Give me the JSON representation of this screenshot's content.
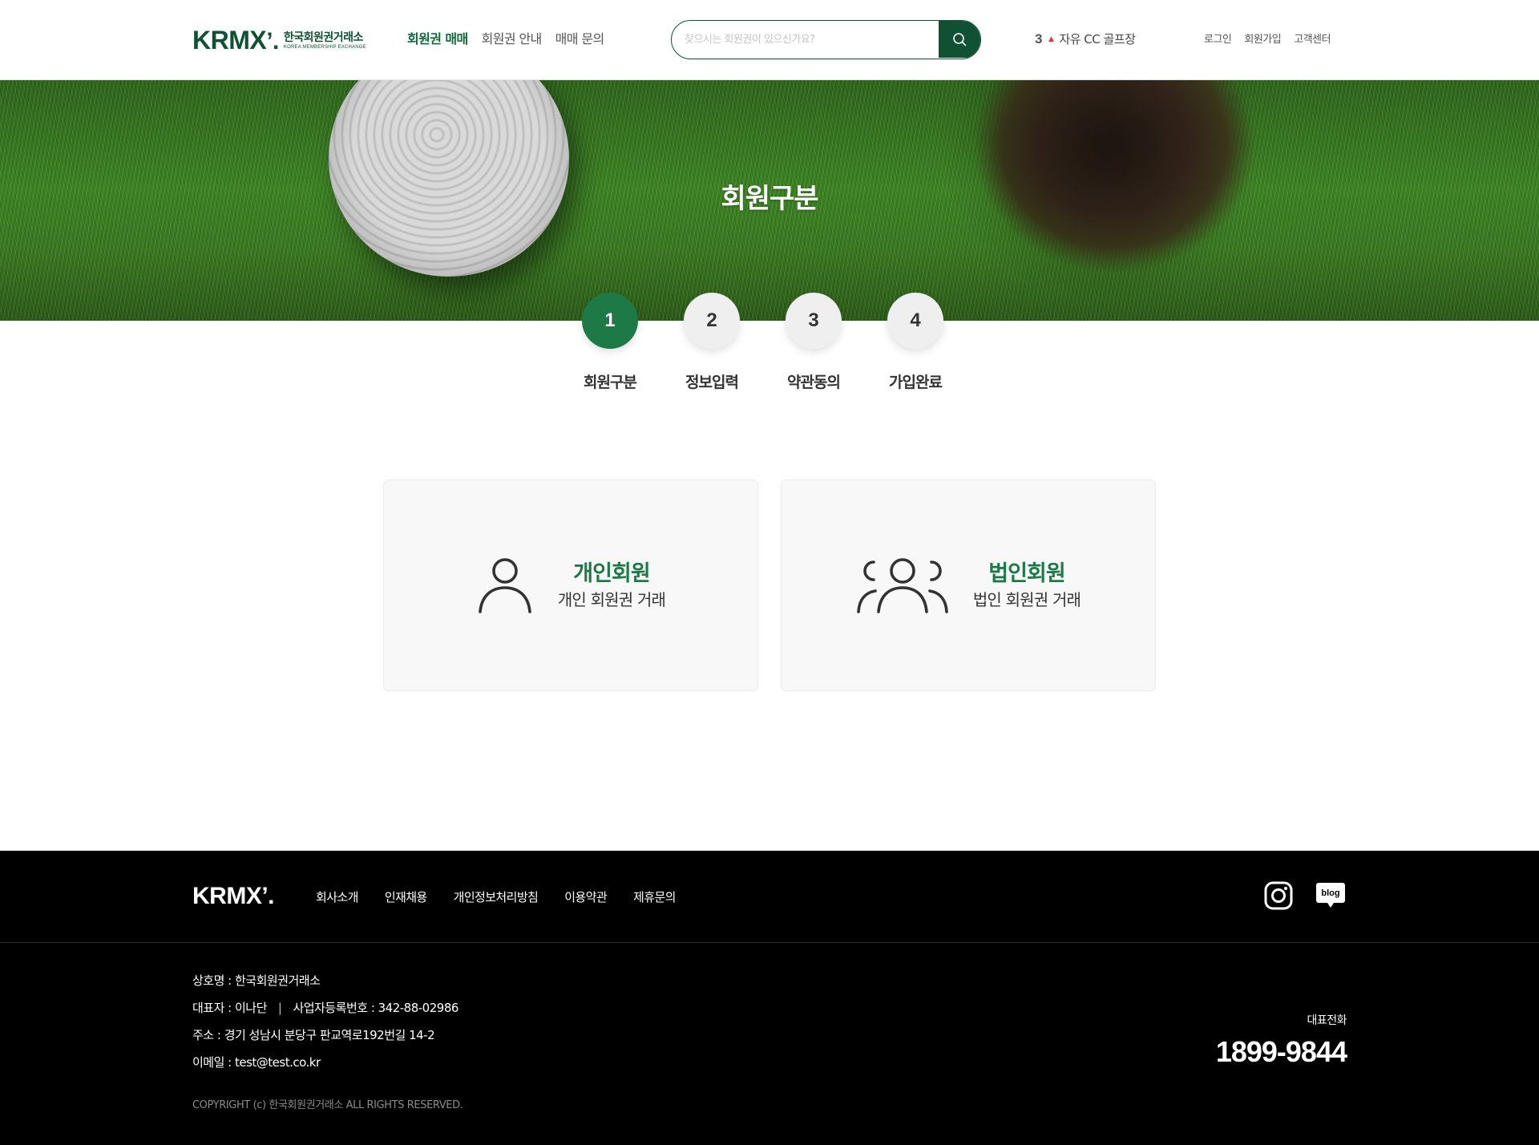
{
  "header": {
    "logo_mark": "KRMX",
    "logo_kr": "한국회원권거래소",
    "logo_en": "KOREA MEMBERSHIP EXCHANGE",
    "nav": [
      "회원권 매매",
      "회원권 안내",
      "매매 문의"
    ],
    "search_placeholder": "찾으시는 회원권이 있으신가요?",
    "ranking": {
      "rank": "3",
      "name": "자유 CC 골프장"
    },
    "util": [
      "로그인",
      "회원가입",
      "고객센터"
    ]
  },
  "hero": {
    "title": "회원구분"
  },
  "steps": [
    {
      "num": "1",
      "label": "회원구분"
    },
    {
      "num": "2",
      "label": "정보입력"
    },
    {
      "num": "3",
      "label": "약관동의"
    },
    {
      "num": "4",
      "label": "가입완료"
    }
  ],
  "cards": [
    {
      "title": "개인회원",
      "desc": "개인 회원권 거래",
      "icon": "person-icon"
    },
    {
      "title": "법인회원",
      "desc": "법인 회원권 거래",
      "icon": "group-icon"
    }
  ],
  "footer": {
    "logo": "KRMX",
    "nav": [
      "회사소개",
      "인재채용",
      "개인정보처리방침",
      "이용약관",
      "제휴문의"
    ],
    "company": "상호명 : 한국회원권거래소",
    "ceo": "대표자 : 이나단",
    "biz_no": "사업자등록번호 : 342-88-02986",
    "address": "주소 : 경기 성남시 분당구 판교역로192번길 14-2",
    "email": "이메일 : test@test.co.kr",
    "copyright": "COPYRIGHT (c) 한국회원권거래소 ALL RIGHTS RESERVED.",
    "tel_label": "대표전화",
    "tel": "1899-9844",
    "sns": {
      "blog_label": "blog"
    }
  },
  "colors": {
    "brand": "#0f5132",
    "accent": "#1d7a47",
    "rank_up": "#e03a3a"
  }
}
